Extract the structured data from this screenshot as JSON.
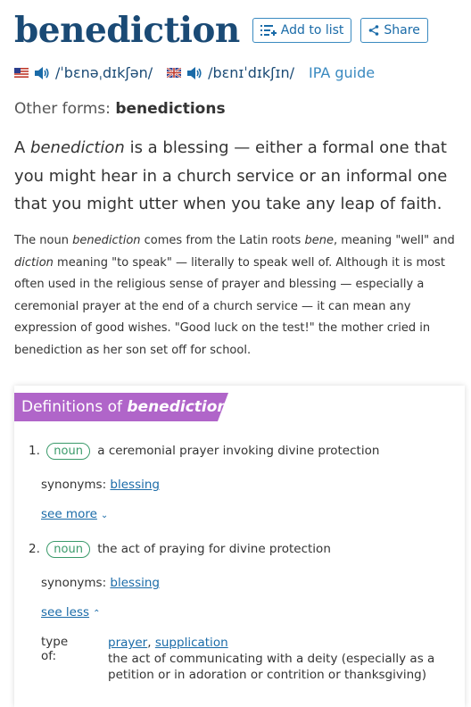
{
  "header": {
    "word": "benediction",
    "add_to_list": "Add to list",
    "share": "Share"
  },
  "pronunciation": {
    "us_ipa": "/ˈbɛnəˌdɪkʃən/",
    "uk_ipa": "/bɛnɪˈdɪkʃɪn/",
    "guide": "IPA guide"
  },
  "forms": {
    "label": "Other forms:",
    "value": "benedictions"
  },
  "blurb": {
    "short_1": "A ",
    "short_em": "benediction",
    "short_2": " is a blessing — either a formal one that you might hear in a church service or an informal one that you might utter when you take any leap of faith.",
    "long_1": "The noun ",
    "long_em1": "benediction",
    "long_2": " comes from the Latin roots ",
    "long_em2": "bene",
    "long_3": ", meaning \"well\" and ",
    "long_em3": "diction",
    "long_4": " meaning \"to speak\" — literally to speak well of. Although it is most often used in the religious sense of prayer and blessing — especially a ceremonial prayer at the end of a church service — it can mean any expression of good wishes. \"Good luck on the test!\" the mother cried in benediction as her son set off for school."
  },
  "definitions": {
    "banner_prefix": "Definitions of ",
    "banner_word": "benediction",
    "senses": [
      {
        "num": "1.",
        "pos": "noun",
        "text": "a ceremonial prayer invoking divine protection",
        "syn_label": "synonyms:",
        "syn": "blessing",
        "toggle": "see more"
      },
      {
        "num": "2.",
        "pos": "noun",
        "text": "the act of praying for divine protection",
        "syn_label": "synonyms:",
        "syn": "blessing",
        "toggle": "see less",
        "type_label": "type of:",
        "type_link1": "prayer",
        "type_sep": ", ",
        "type_link2": "supplication",
        "type_text": "the act of communicating with a deity (especially as a petition or in adoration or contrition or thanksgiving)"
      }
    ]
  }
}
